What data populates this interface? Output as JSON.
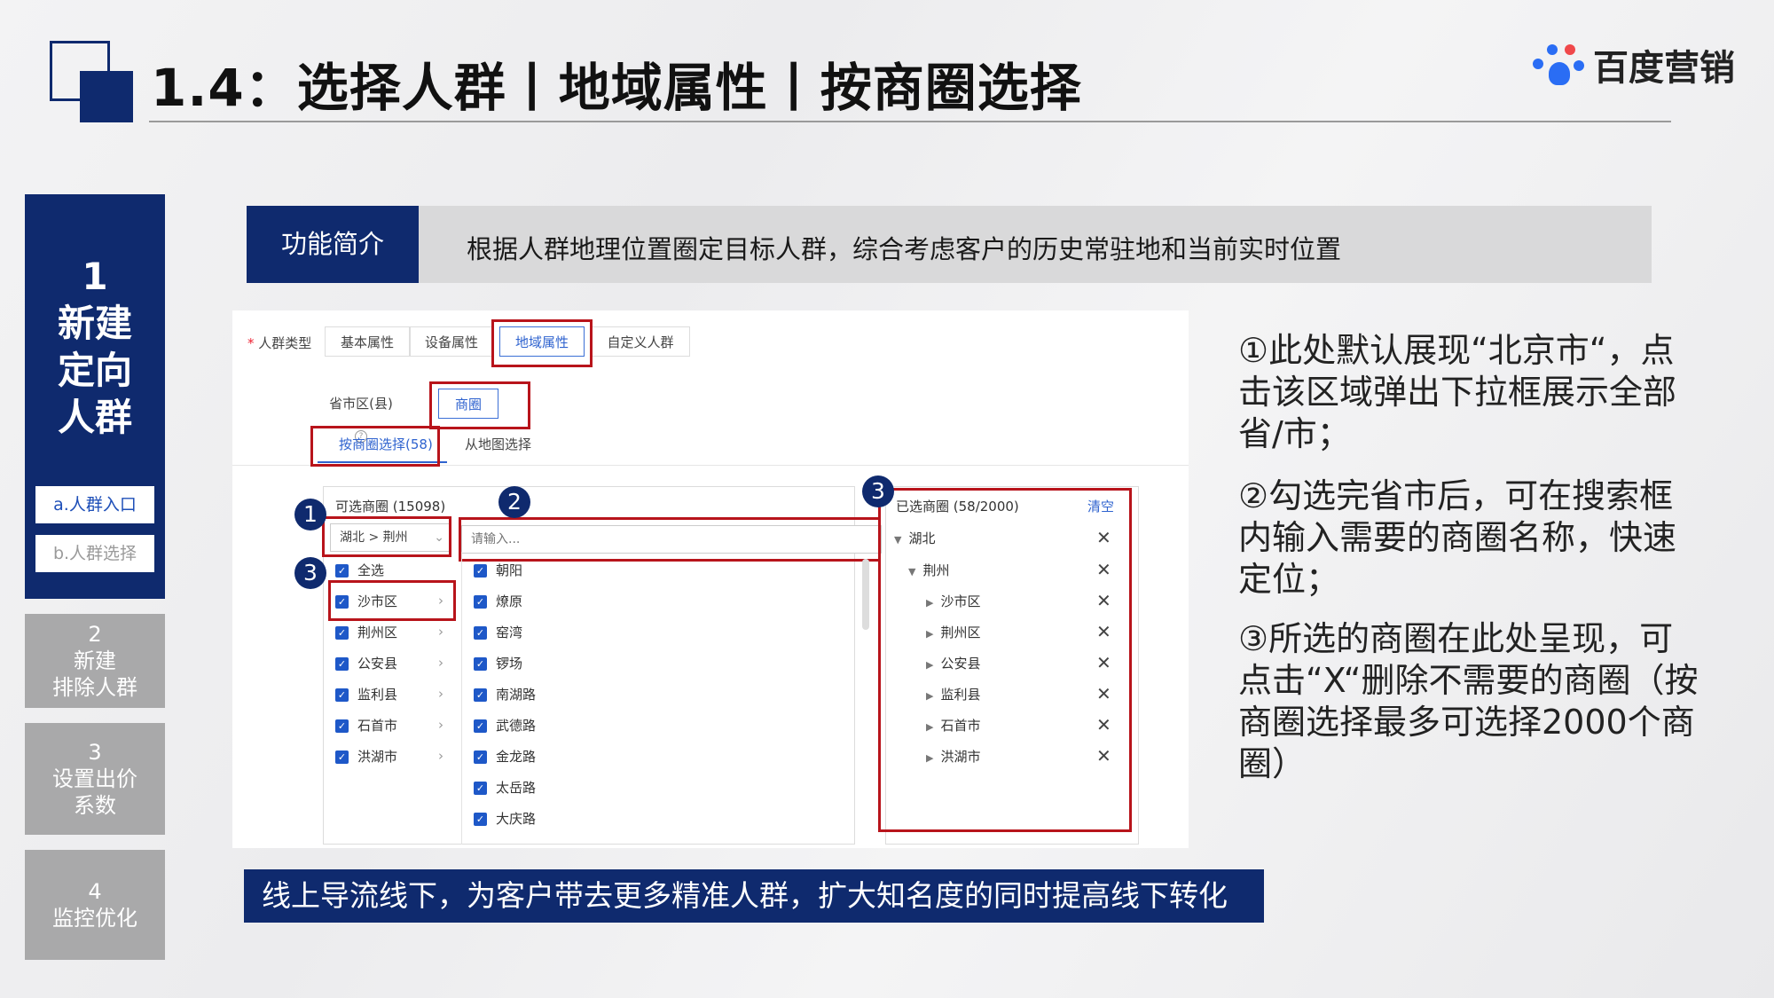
{
  "header": {
    "title": "1.4：选择人群丨地域属性丨按商圈选择",
    "brand": "百度营销"
  },
  "nav": {
    "step1": {
      "num": "1",
      "l1": "新建",
      "l2": "定向",
      "l3": "人群"
    },
    "sub_a": "a.人群入口",
    "sub_b": "b.人群选择",
    "step2": {
      "num": "2",
      "l1": "新建",
      "l2": "排除人群"
    },
    "step3": {
      "num": "3",
      "l1": "设置出价",
      "l2": "系数"
    },
    "step4": {
      "num": "4",
      "l1": "监控优化"
    }
  },
  "intro": {
    "tag": "功能简介",
    "text": "根据人群地理位置圈定目标人群，综合考虑客户的历史常驻地和当前实时位置"
  },
  "screenshot": {
    "crowd_type_label": "人群类型",
    "required_star": "*",
    "tabs": [
      "基本属性",
      "设备属性",
      "地域属性",
      "自定义人群"
    ],
    "region_tabs": [
      "省市区(县)",
      "商圈"
    ],
    "help_icon": "?",
    "subtabs": [
      "按商圈选择(58)",
      "从地图选择"
    ],
    "available_header": "可选商圈 (15098)",
    "province_select": "湖北 > 荆州",
    "search_placeholder": "请输入...",
    "select_all": "全选",
    "districts": [
      "沙市区",
      "荆州区",
      "公安县",
      "监利县",
      "石首市",
      "洪湖市"
    ],
    "areas": [
      "朝阳",
      "燎原",
      "窑湾",
      "锣场",
      "南湖路",
      "武德路",
      "金龙路",
      "太岳路",
      "大庆路"
    ],
    "selected_header": "已选商圈 (58/2000)",
    "clear_label": "清空",
    "selected_tree": {
      "province": "湖北",
      "city": "荆州",
      "districts": [
        "沙市区",
        "荆州区",
        "公安县",
        "监利县",
        "石首市",
        "洪湖市"
      ]
    },
    "badges": [
      "1",
      "2",
      "3",
      "3"
    ]
  },
  "notes": {
    "n1": "①此处默认展现“北京市“，点击该区域弹出下拉框展示全部省/市；",
    "n2": "②勾选完省市后，可在搜索框内输入需要的商圈名称，快速定位；",
    "n3": "③所选的商圈在此处呈现，可点击“X“删除不需要的商圈（按商圈选择最多可选择2000个商圈）"
  },
  "banner": "线上导流线下，为客户带去更多精准人群，扩大知名度的同时提高线下转化",
  "colors": {
    "navy": "#0f2a6e",
    "red": "#b8141b",
    "blue": "#1e58c8"
  }
}
